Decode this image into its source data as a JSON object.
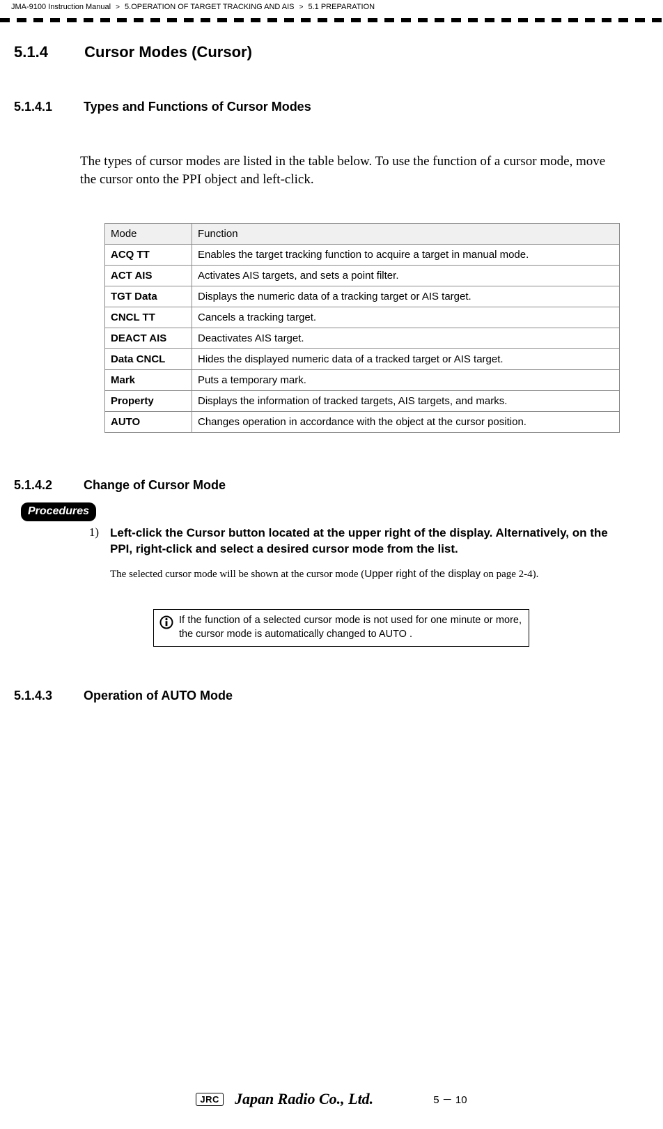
{
  "breadcrumb": {
    "a": "JMA-9100 Instruction Manual",
    "b": "5.OPERATION OF TARGET TRACKING AND AIS",
    "c": "5.1  PREPARATION"
  },
  "sec_5_1_4": {
    "num": "5.1.4",
    "title": "Cursor Modes (Cursor)"
  },
  "sec_5_1_4_1": {
    "num": "5.1.4.1",
    "title": "Types and Functions of Cursor Modes"
  },
  "intro": "The types of cursor modes are listed in the table below. To use the function of a cursor mode, move the cursor onto the PPI object and left-click.",
  "table": {
    "head_mode": "Mode",
    "head_func": "Function",
    "rows": [
      {
        "mode": "ACQ TT",
        "func": "Enables the target tracking function to acquire a target in manual mode."
      },
      {
        "mode": "ACT AIS",
        "func": "Activates AIS targets, and sets a point filter."
      },
      {
        "mode": "TGT Data",
        "func": "Displays the numeric data of a tracking target or AIS target."
      },
      {
        "mode": "CNCL TT",
        "func": "Cancels a tracking target."
      },
      {
        "mode": "DEACT AIS",
        "func": "Deactivates AIS target."
      },
      {
        "mode": "Data CNCL",
        "func": "Hides the displayed numeric data of a tracked target or AIS target."
      },
      {
        "mode": "Mark",
        "func": "Puts a temporary mark."
      },
      {
        "mode": "Property",
        "func": "Displays the information of tracked targets, AIS targets, and marks."
      },
      {
        "mode": "AUTO",
        "func": "Changes operation in accordance with the object at the cursor position."
      }
    ]
  },
  "sec_5_1_4_2": {
    "num": "5.1.4.2",
    "title": "Change of Cursor Mode"
  },
  "procedures_label": "Procedures",
  "step1_num": "1)",
  "step1_text": "Left-click the  Cursor  button located at the upper right of the display. Alternatively, on the PPI, right-click and select a desired cursor mode from the list.",
  "step1_body_a": "The selected cursor mode will be shown at the cursor mode (",
  "step1_body_b": "Upper right of the display",
  "step1_body_c": " on page 2-4).",
  "note_text": "If the function of a selected cursor mode is not used for one minute or more, the cursor mode is automatically changed to AUTO .",
  "sec_5_1_4_3": {
    "num": "5.1.4.3",
    "title": "Operation of AUTO Mode"
  },
  "footer": {
    "jrc_box": "JRC",
    "jrc_script": "Japan Radio Co., Ltd.",
    "page": "5 － 10"
  }
}
